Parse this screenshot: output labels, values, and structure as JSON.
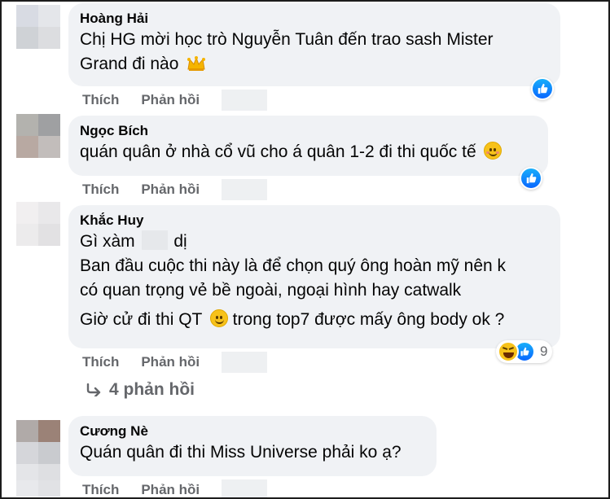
{
  "colors": {
    "bubble": "#f0f2f5",
    "muted_text": "#65676b",
    "like_blue": "#0866ff",
    "emoji_yellow": "#f7c21a"
  },
  "actions": {
    "like": "Thích",
    "reply": "Phản hồi"
  },
  "comments": [
    {
      "name": "Hoàng Hải",
      "line1": "Chị HG mời học trò Nguyễn Tuân đến trao sash Mister",
      "line2": "Grand đi nào",
      "emoji": "crown-emoji",
      "reaction": "like-icon"
    },
    {
      "name": "Ngọc Bích",
      "line1": "quán quân ở nhà cổ vũ cho á quân 1-2 đi thi quốc tế",
      "emoji": "blush-smile-emoji",
      "reaction": "like-icon"
    },
    {
      "name": "Khắc Huy",
      "line1_before": "Gì xàm",
      "line1_after": "dị",
      "para2_line1": "Ban đầu cuộc thi này là để chọn quý ông hoàn mỹ nên k",
      "para2_line2": "có quan trọng vẻ bề ngoài, ngoại hình hay catwalk",
      "para3_before": "Giờ cử đi thi QT",
      "para3_after": "trong top7 được mấy ông body ok ?",
      "reaction_count": "9",
      "reactions": [
        "haha-icon",
        "like-icon"
      ]
    },
    {
      "name": "Cương Nè",
      "line1": "Quán quân đi thi Miss Universe phải ko ạ?"
    }
  ],
  "view_replies": "4 phản hồi"
}
